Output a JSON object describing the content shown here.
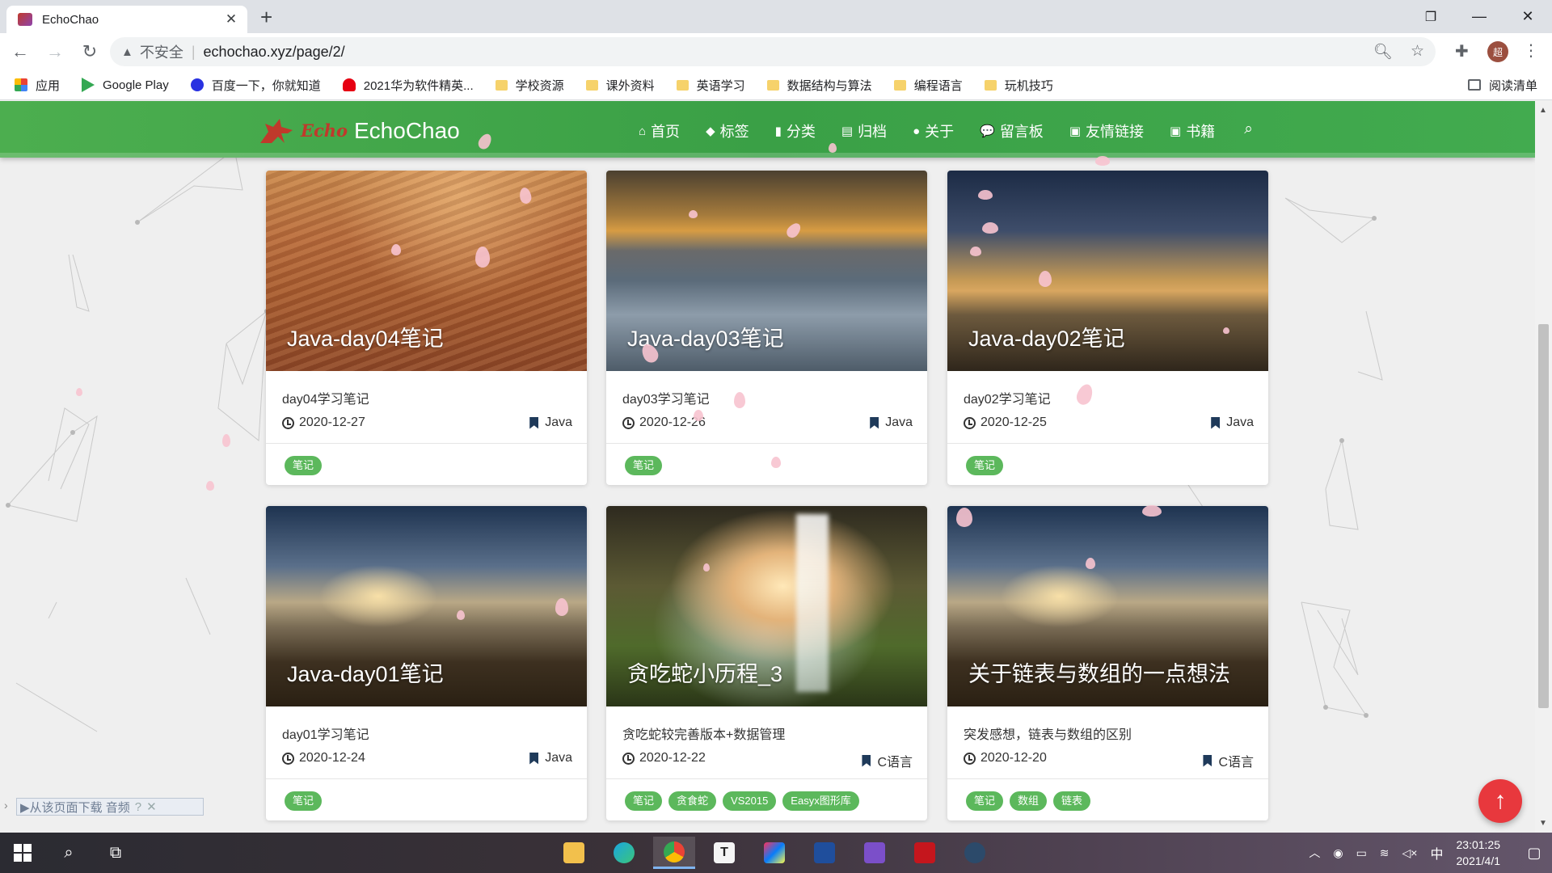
{
  "browser": {
    "tab_title": "EchoChao",
    "new_tab": "+",
    "address_security": "不安全",
    "address_url": "echochao.xyz/page/2/",
    "window_controls": {
      "minimize": "—",
      "maximize": "❐",
      "close": "✕"
    }
  },
  "bookmarks": [
    {
      "label": "应用",
      "icon": "apps-grid-icon"
    },
    {
      "label": "Google Play",
      "icon": "google-play-icon"
    },
    {
      "label": "百度一下，你就知道",
      "icon": "baidu-icon"
    },
    {
      "label": "2021华为软件精英...",
      "icon": "huawei-icon"
    },
    {
      "label": "学校资源",
      "icon": "folder-icon"
    },
    {
      "label": "课外资料",
      "icon": "folder-icon"
    },
    {
      "label": "英语学习",
      "icon": "folder-icon"
    },
    {
      "label": "数据结构与算法",
      "icon": "folder-icon"
    },
    {
      "label": "编程语言",
      "icon": "folder-icon"
    },
    {
      "label": "玩机技巧",
      "icon": "folder-icon"
    }
  ],
  "reading_list": "阅读清单",
  "site": {
    "logo_word": "Echo",
    "name": "EchoChao",
    "nav": [
      {
        "label": "首页",
        "icon": "home-icon",
        "glyph": "⌂"
      },
      {
        "label": "标签",
        "icon": "tags-icon",
        "glyph": "◆"
      },
      {
        "label": "分类",
        "icon": "bookmark-icon",
        "glyph": "▮"
      },
      {
        "label": "归档",
        "icon": "archive-icon",
        "glyph": "▤"
      },
      {
        "label": "关于",
        "icon": "user-circle-icon",
        "glyph": "●"
      },
      {
        "label": "留言板",
        "icon": "comments-icon",
        "glyph": "💬"
      },
      {
        "label": "友情链接",
        "icon": "address-book-icon",
        "glyph": "▣"
      },
      {
        "label": "书籍",
        "icon": "book-icon",
        "glyph": "▣"
      }
    ]
  },
  "posts": [
    {
      "title": "Java-day04笔记",
      "summary": "day04学习笔记",
      "date": "2020-12-27",
      "category": "Java",
      "tags": [
        "笔记"
      ]
    },
    {
      "title": "Java-day03笔记",
      "summary": "day03学习笔记",
      "date": "2020-12-26",
      "category": "Java",
      "tags": [
        "笔记"
      ]
    },
    {
      "title": "Java-day02笔记",
      "summary": "day02学习笔记",
      "date": "2020-12-25",
      "category": "Java",
      "tags": [
        "笔记"
      ]
    },
    {
      "title": "Java-day01笔记",
      "summary": "day01学习笔记",
      "date": "2020-12-24",
      "category": "Java",
      "tags": [
        "笔记"
      ]
    },
    {
      "title": "贪吃蛇小历程_3",
      "summary": "贪吃蛇较完善版本+数据管理",
      "date": "2020-12-22",
      "category": "C语言",
      "tags": [
        "笔记",
        "贪食蛇",
        "VS2015",
        "Easyx图形库"
      ]
    },
    {
      "title": "关于链表与数组的一点想法",
      "summary": "突发感想，链表与数组的区别",
      "date": "2020-12-20",
      "category": "C语言",
      "tags": [
        "笔记",
        "数组",
        "链表"
      ]
    }
  ],
  "download_bar": "▶从该页面下载 音频",
  "taskbar": {
    "time": "23:01:25",
    "date": "2021/4/1",
    "ime": "中"
  }
}
